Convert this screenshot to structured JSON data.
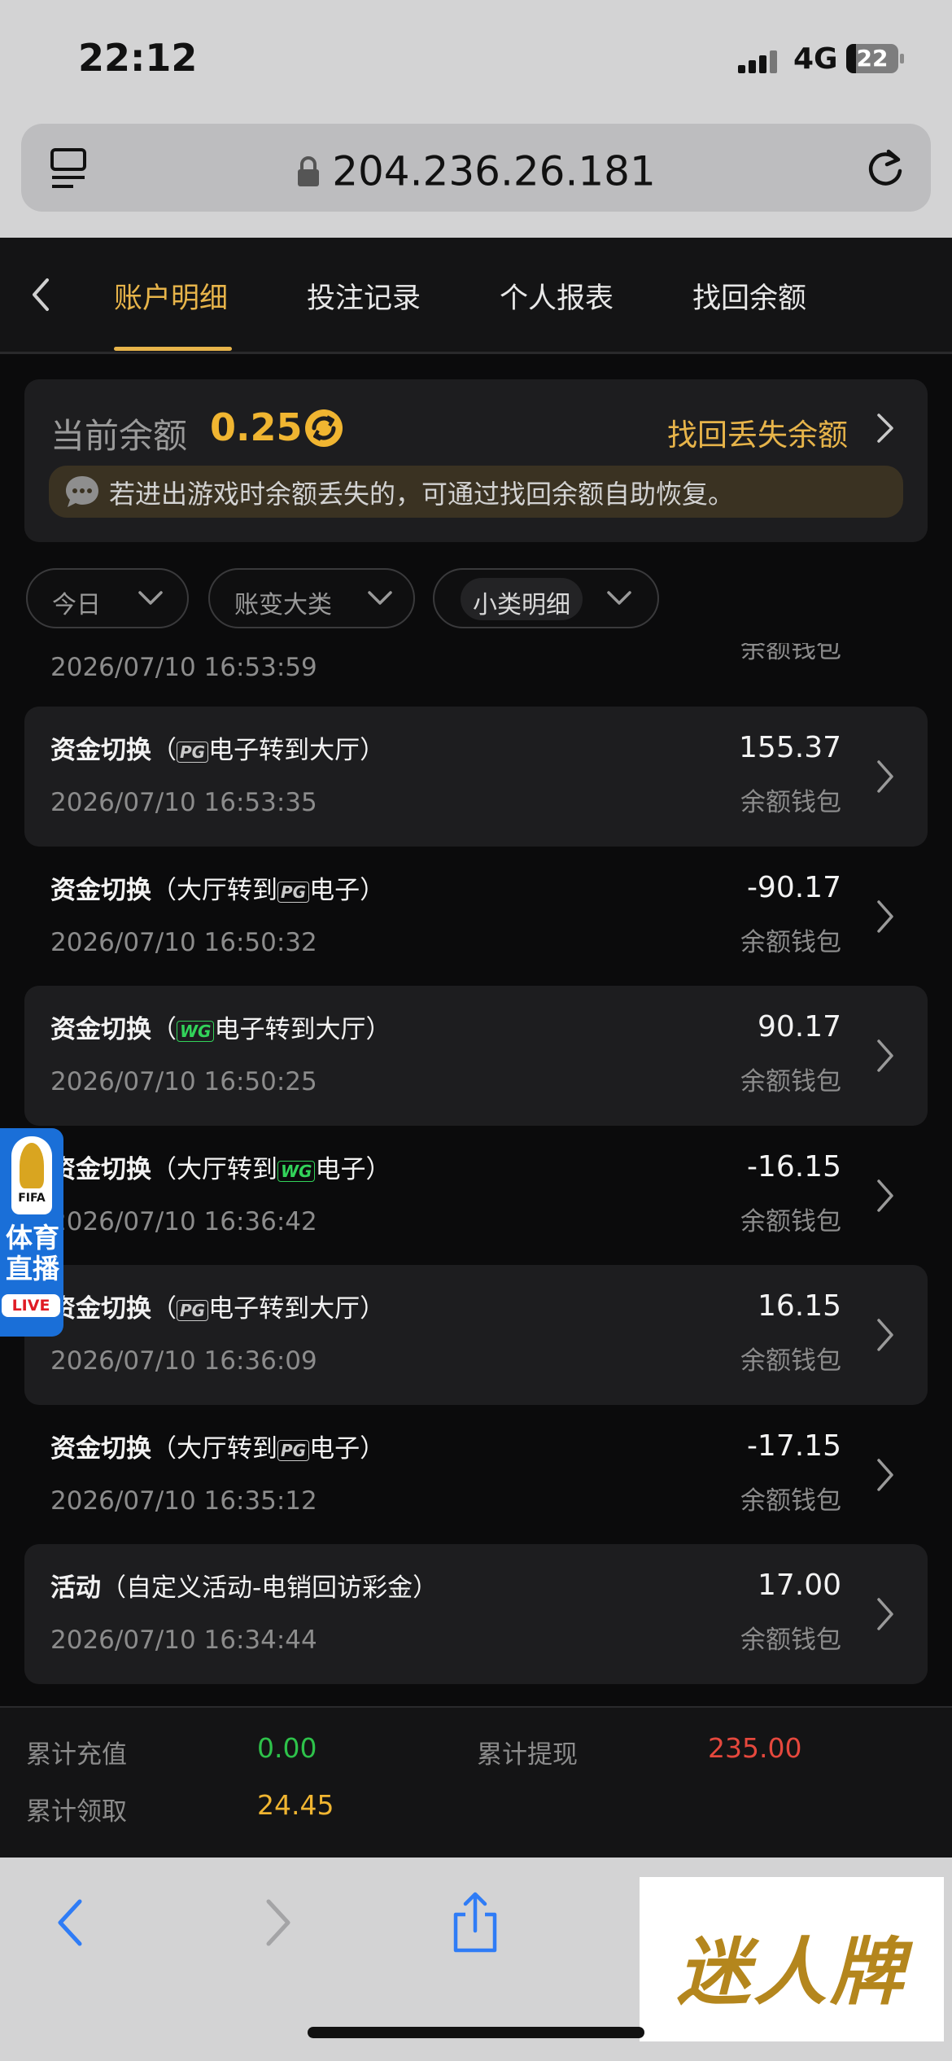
{
  "status_bar": {
    "time": "22:12",
    "network": "4G",
    "battery": "22"
  },
  "browser": {
    "url": "204.236.26.181"
  },
  "tabs": [
    {
      "label": "账户明细",
      "active": true
    },
    {
      "label": "投注记录",
      "active": false
    },
    {
      "label": "个人报表",
      "active": false
    },
    {
      "label": "找回余额",
      "active": false
    }
  ],
  "balance": {
    "label": "当前余额",
    "value": "0.25",
    "recover_link": "找回丢失余额",
    "notice": "若进出游戏时余额丢失的，可通过找回余额自助恢复。"
  },
  "filters": [
    {
      "label": "今日"
    },
    {
      "label": "账变大类"
    },
    {
      "label": "小类明细"
    }
  ],
  "partial_row": {
    "date": "2026/07/10 16:53:59",
    "wallet": "余额钱包"
  },
  "records": [
    {
      "title": "资金切换",
      "detail_pre": "（",
      "tag": "PG",
      "detail_post": "电子转到大厅）",
      "date": "2026/07/10 16:53:35",
      "amount": "155.37",
      "wallet": "余额钱包"
    },
    {
      "title": "资金切换",
      "detail_pre": "（大厅转到",
      "tag": "PG",
      "detail_post": "电子）",
      "date": "2026/07/10 16:50:32",
      "amount": "-90.17",
      "wallet": "余额钱包"
    },
    {
      "title": "资金切换",
      "detail_pre": "（",
      "tag": "WG",
      "detail_post": "电子转到大厅）",
      "date": "2026/07/10 16:50:25",
      "amount": "90.17",
      "wallet": "余额钱包"
    },
    {
      "title": "资金切换",
      "detail_pre": "（大厅转到",
      "tag": "WG",
      "detail_post": "电子）",
      "date": "2026/07/10 16:36:42",
      "amount": "-16.15",
      "wallet": "余额钱包"
    },
    {
      "title": "资金切换",
      "detail_pre": "（",
      "tag": "PG",
      "detail_post": "电子转到大厅）",
      "date": "2026/07/10 16:36:09",
      "amount": "16.15",
      "wallet": "余额钱包"
    },
    {
      "title": "资金切换",
      "detail_pre": "（大厅转到",
      "tag": "PG",
      "detail_post": "电子）",
      "date": "2026/07/10 16:35:12",
      "amount": "-17.15",
      "wallet": "余额钱包"
    },
    {
      "title": "活动",
      "detail_pre": "（自定义活动-电销回访彩金）",
      "tag": "",
      "detail_post": "",
      "date": "2026/07/10 16:34:44",
      "amount": "17.00",
      "wallet": "余额钱包"
    }
  ],
  "summary": {
    "recharge_label": "累计充值",
    "recharge_value": "0.00",
    "withdraw_label": "累计提现",
    "withdraw_value": "235.00",
    "claim_label": "累计领取",
    "claim_value": "24.45"
  },
  "live_badge": {
    "title": "体育直播",
    "chip": "LIVE",
    "logo_text": "FIFA"
  },
  "watermark": {
    "text": "迷人牌"
  },
  "colors": {
    "accent": "#e7b44a",
    "balance": "#f0b531",
    "green": "#2ec24a",
    "red": "#e5483d",
    "link_blue": "#2f7cf6"
  }
}
